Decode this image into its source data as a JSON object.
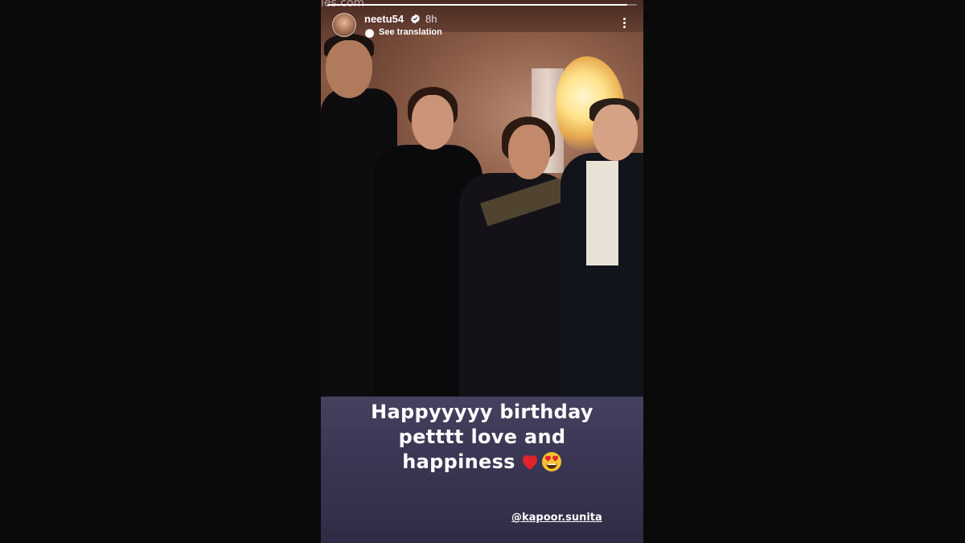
{
  "story": {
    "progress": 0.97,
    "watermark": "ies.com",
    "header": {
      "username": "neetu54",
      "verified": true,
      "time_ago": "8h",
      "see_translation": "See translation"
    },
    "caption": {
      "line1": "Happyyyyy birthday",
      "line2": "petttt love and",
      "line3": "happiness"
    },
    "mention": "@kapoor.sunita",
    "colors": {
      "caption_background": "#3a3754",
      "text": "#ffffff",
      "page_background": "#0a0a0a",
      "verified_badge": "#ffffff",
      "heart": "#e0242c"
    },
    "icons": [
      "avatar",
      "verified-badge-icon",
      "translate-icon",
      "more-options-icon",
      "heart-emoji",
      "heart-eyes-emoji"
    ]
  }
}
